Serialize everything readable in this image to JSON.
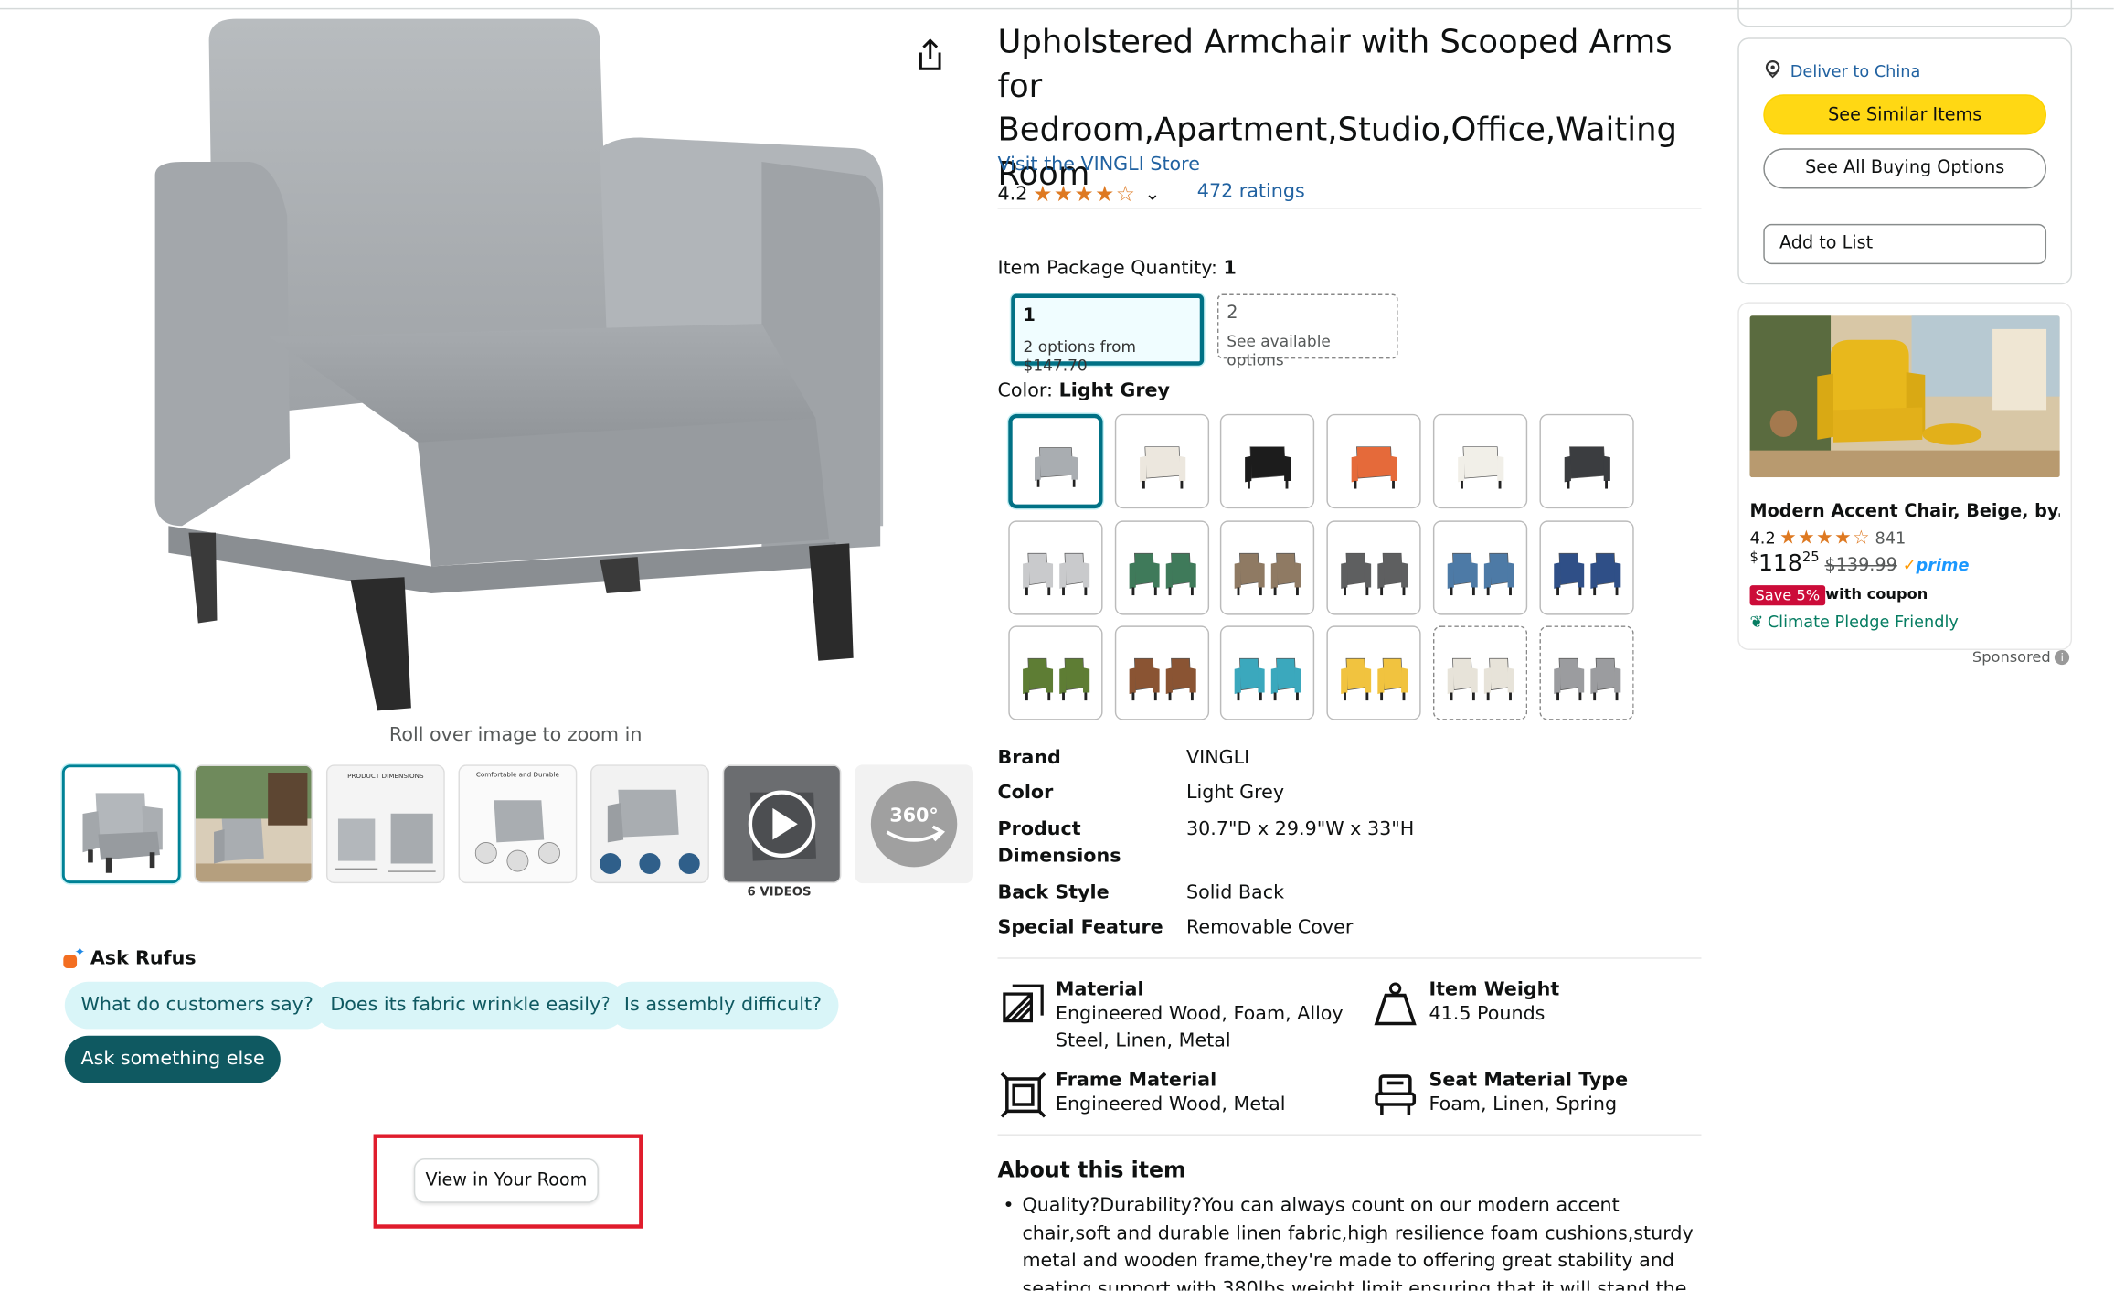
{
  "gallery": {
    "zoom_hint": "Roll over image to zoom in",
    "thumbnails": [
      {
        "name": "main-front"
      },
      {
        "name": "living-room"
      },
      {
        "name": "product-dimensions",
        "label": "PRODUCT DIMENSIONS"
      },
      {
        "name": "comfortable-durable",
        "label": "Comfortable and Durable"
      },
      {
        "name": "feature-icons"
      },
      {
        "name": "videos",
        "caption": "6 VIDEOS"
      },
      {
        "name": "view-360",
        "label": "360°"
      }
    ]
  },
  "rufus": {
    "heading": "Ask Rufus",
    "chips": [
      "What do customers say?",
      "Does its fabric wrinkle easily?",
      "Is assembly difficult?"
    ],
    "ask_else": "Ask something else"
  },
  "view_in_room": "View in Your Room",
  "product": {
    "title": "Upholstered Armchair with Scooped Arms for Bedroom,Apartment,Studio,Office,Waiting Room",
    "store_link": "Visit the VINGLI Store",
    "rating": "4.2",
    "stars": "★★★★☆",
    "ratings_count": "472 ratings",
    "package_qty_label": "Item Package Quantity:",
    "package_qty_value": "1",
    "qty_options": [
      {
        "qty": "1",
        "sub": "2 options from $147.70"
      },
      {
        "qty": "2",
        "sub": "See available options"
      }
    ],
    "color_label": "Color:",
    "color_value": "Light Grey",
    "swatches": [
      "#a9adb1",
      "#ece7de",
      "#1c1c1c",
      "#e56a3a",
      "#f1efe8",
      "#3b3d40",
      "#c9cacc",
      "#3f7a5a",
      "#8f7a63",
      "#5e5f60",
      "#4d7aa6",
      "#2f4f87",
      "#5e7d34",
      "#8a5433",
      "#3ba8bd",
      "#f1c33f",
      "#e7e3d9",
      "#9b9c9f"
    ],
    "specs": [
      {
        "k": "Brand",
        "v": "VINGLI"
      },
      {
        "k": "Color",
        "v": "Light Grey"
      },
      {
        "k": "Product Dimensions",
        "v": "30.7\"D x 29.9\"W x 33\"H"
      },
      {
        "k": "Back Style",
        "v": "Solid Back"
      },
      {
        "k": "Special Feature",
        "v": "Removable Cover"
      }
    ],
    "features": [
      {
        "title": "Material",
        "value": "Engineered Wood, Foam, Alloy Steel, Linen, Metal"
      },
      {
        "title": "Item Weight",
        "value": "41.5 Pounds"
      },
      {
        "title": "Frame Material",
        "value": "Engineered Wood, Metal"
      },
      {
        "title": "Seat Material Type",
        "value": "Foam, Linen, Spring"
      }
    ],
    "about_heading": "About this item",
    "about_bullet": "Quality?Durability?You can always count on our modern accent chair,soft and durable linen fabric,high resilience foam cushions,sturdy metal and wooden frame,they're made to offering great stability and seating support with 380lbs weight limit,ensuring that it will stand the test of time."
  },
  "buybox": {
    "deliver": "Deliver to China",
    "see_similar": "See Similar Items",
    "see_all": "See All Buying Options",
    "add_to_list": "Add to List"
  },
  "ad": {
    "title": "Modern Accent Chair, Beige, by...",
    "rating": "4.2",
    "stars": "★★★★☆",
    "count": "841",
    "price_currency": "$",
    "price_whole": "118",
    "price_fraction": "25",
    "list_price": "$139.99",
    "prime": "prime",
    "save": "Save 5%",
    "coupon": "with coupon",
    "climate": "Climate Pledge Friendly",
    "sponsored": "Sponsored"
  }
}
